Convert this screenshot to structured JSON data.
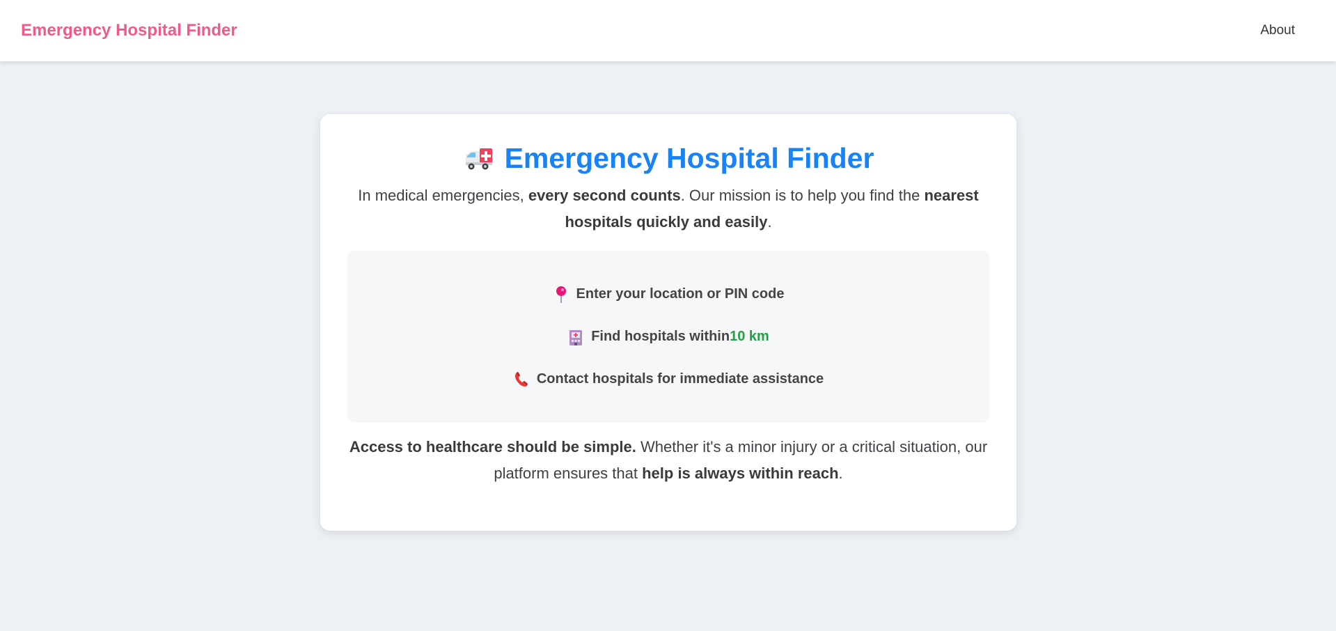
{
  "navbar": {
    "brand": "Emergency Hospital Finder",
    "about_link": "About",
    "brand_color": "#f05a86"
  },
  "card": {
    "title_icon": "ambulance-icon",
    "title": "Emergency Hospital Finder",
    "title_color": "#1a82f7",
    "intro": {
      "part1": "In medical emergencies, ",
      "bold1": "every second counts",
      "part2": ". Our mission is to help you find the ",
      "bold2": "nearest hospitals quickly and easily",
      "part3": "."
    },
    "steps": [
      {
        "icon": "pushpin-icon",
        "text": "Enter your location or PIN code"
      },
      {
        "icon": "hospital-icon",
        "text": "Find hospitals within ",
        "accent": "10 km"
      },
      {
        "icon": "telephone-icon",
        "text": "Contact hospitals for immediate assistance"
      }
    ],
    "accent_color": "#22a046",
    "outro": {
      "bold1": "Access to healthcare should be simple.",
      "part1": " Whether it's a minor injury or a critical situation, our platform ensures that ",
      "bold2": "help is always within reach",
      "part2": "."
    }
  }
}
